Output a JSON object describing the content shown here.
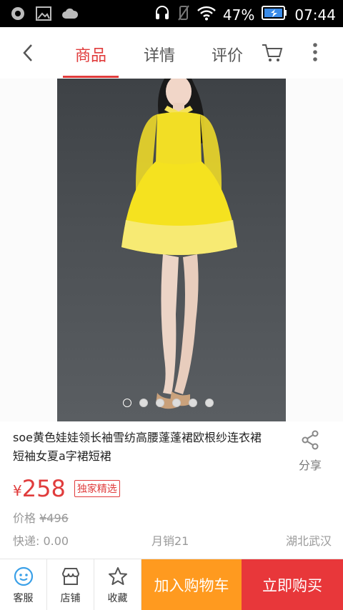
{
  "status_bar": {
    "battery": "47%",
    "time": "07:44"
  },
  "nav": {
    "tabs": [
      {
        "label": "商品",
        "active": true
      },
      {
        "label": "详情",
        "active": false
      },
      {
        "label": "评价",
        "active": false
      }
    ],
    "accent_color": "#e03c3c"
  },
  "gallery": {
    "page_count": 6,
    "current_page": 1
  },
  "product": {
    "title": "soe黄色娃娃领长袖雪纺高腰蓬蓬裙欧根纱连衣裙短袖女夏a字裙短裙",
    "share_label": "分享",
    "currency": "¥",
    "price": "258",
    "badge": "独家精选",
    "original_price_label": "价格",
    "original_price": "¥496",
    "shipping": "快递: 0.00",
    "monthly_sales": "月销21",
    "location": "湖北武汉"
  },
  "bottom_bar": {
    "service_label": "客服",
    "shop_label": "店铺",
    "favorite_label": "收藏",
    "add_to_cart_label": "加入购物车",
    "buy_now_label": "立即购买",
    "cart_color": "#ff9a1f",
    "buy_color": "#e8373a"
  }
}
